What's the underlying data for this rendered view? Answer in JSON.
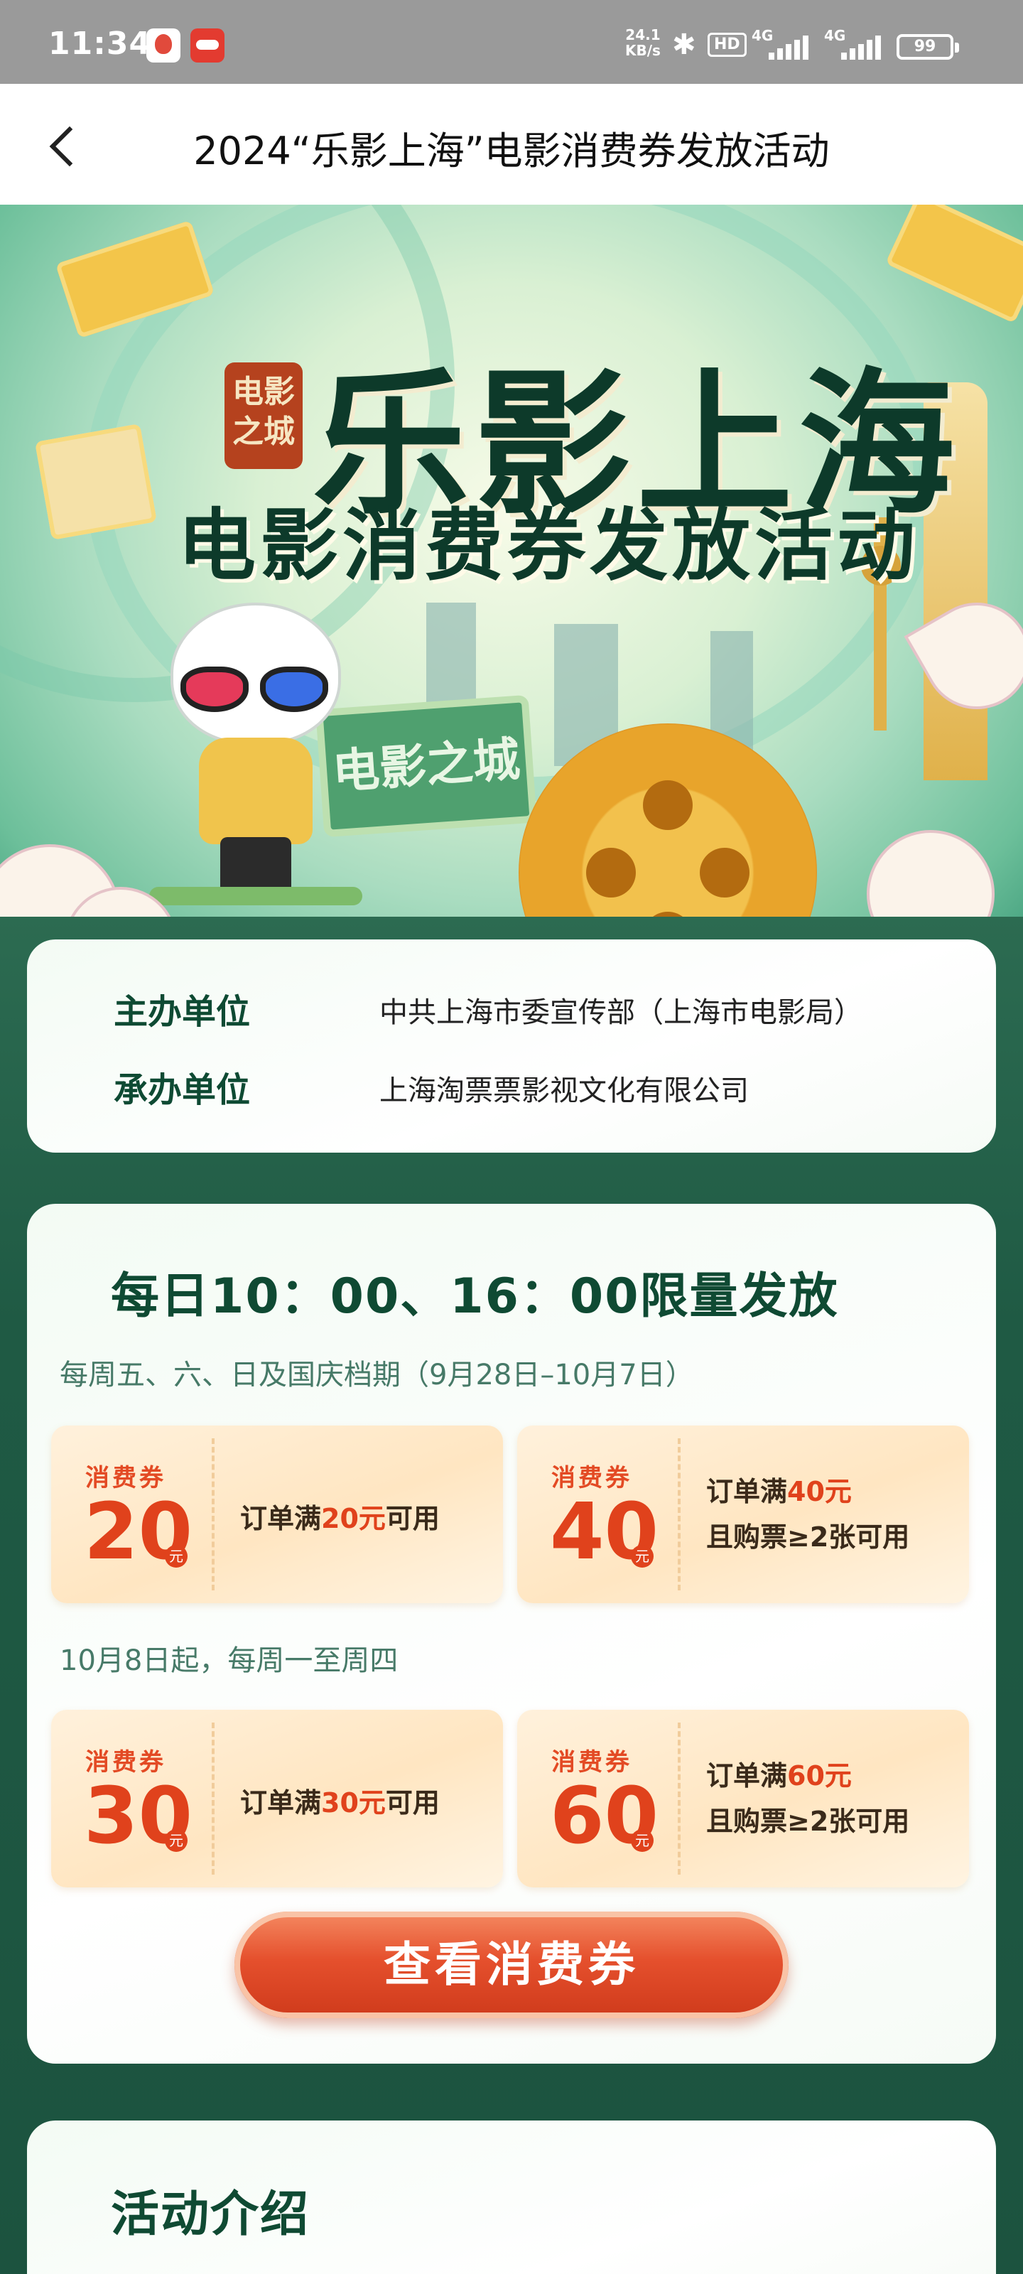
{
  "status_bar": {
    "time": "11:34",
    "net_speed_value": "24.1",
    "net_speed_unit": "KB/s",
    "hd_label": "HD",
    "sim1": "4G",
    "sim2": "4G",
    "battery": "99"
  },
  "nav": {
    "title": "2024“乐影上海”电影消费券发放活动"
  },
  "hero": {
    "title": "乐影上海",
    "subtitle": "电影消费券发放活动",
    "seal_text": "电影之城",
    "sign_text": "电影之城"
  },
  "organizers": [
    {
      "label": "主办单位",
      "value": "中共上海市委宣传部（上海市电影局）"
    },
    {
      "label": "承办单位",
      "value": "上海淘票票影视文化有限公司"
    }
  ],
  "coupons_section": {
    "title": "每日10：00、16：00限量发放",
    "groups": [
      {
        "period": "每周五、六、日及国庆档期（9月28日–10月7日）",
        "coupons": [
          {
            "kind": "消费券",
            "amount": "20",
            "unit": "元",
            "cond_prefix": "订单满",
            "cond_value": "20元",
            "cond_suffix": "可用",
            "cond_line2": ""
          },
          {
            "kind": "消费券",
            "amount": "40",
            "unit": "元",
            "cond_prefix": "订单满",
            "cond_value": "40元",
            "cond_suffix": "",
            "cond_line2": "且购票≥2张可用"
          }
        ]
      },
      {
        "period": "10月8日起，每周一至周四",
        "coupons": [
          {
            "kind": "消费券",
            "amount": "30",
            "unit": "元",
            "cond_prefix": "订单满",
            "cond_value": "30元",
            "cond_suffix": "可用",
            "cond_line2": ""
          },
          {
            "kind": "消费券",
            "amount": "60",
            "unit": "元",
            "cond_prefix": "订单满",
            "cond_value": "60元",
            "cond_suffix": "",
            "cond_line2": "且购票≥2张可用"
          }
        ]
      }
    ],
    "plus_symbol": "+",
    "button_label": "查看消费券"
  },
  "intro_section": {
    "title": "活动介绍"
  },
  "colors": {
    "page_green": "#1f5a44",
    "accent_red": "#e0421c",
    "title_green": "#0f4a33"
  }
}
